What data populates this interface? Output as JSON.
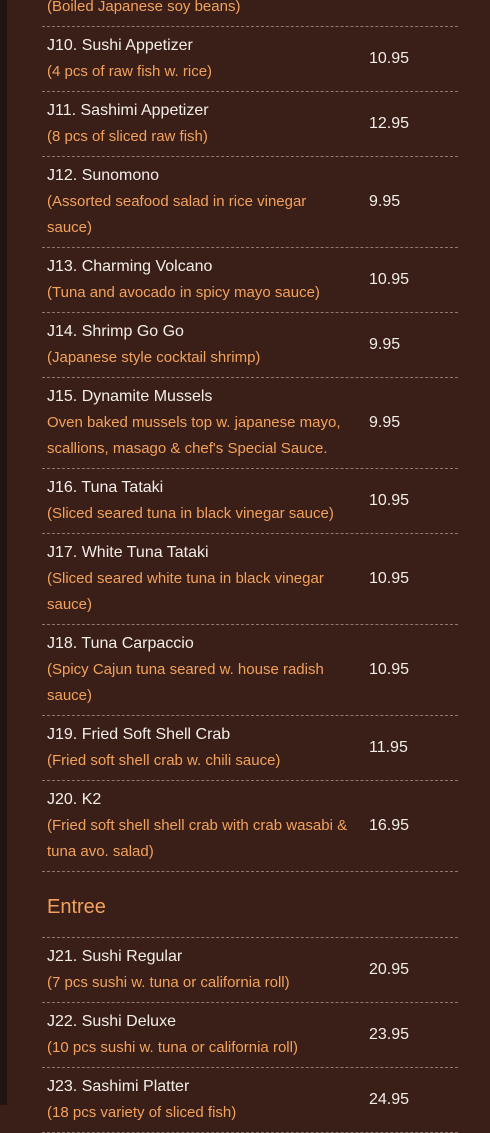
{
  "items_top": [
    {
      "name": "",
      "desc": "(Boiled Japanese soy beans)",
      "price": ""
    },
    {
      "name": "J10. Sushi Appetizer",
      "desc": "(4 pcs of raw fish w. rice)",
      "price": "10.95"
    },
    {
      "name": "J11. Sashimi Appetizer",
      "desc": "(8 pcs of sliced raw fish)",
      "price": "12.95"
    },
    {
      "name": "J12. Sunomono",
      "desc": "(Assorted seafood salad in rice vinegar sauce)",
      "price": "9.95"
    },
    {
      "name": "J13. Charming Volcano",
      "desc": "(Tuna and avocado in spicy mayo sauce)",
      "price": "10.95"
    },
    {
      "name": "J14. Shrimp Go Go",
      "desc": "(Japanese style cocktail shrimp)",
      "price": "9.95"
    },
    {
      "name": "J15. Dynamite Mussels",
      "desc": "Oven baked mussels top w. japanese mayo, scallions, masago & chef's Special Sauce.",
      "price": "9.95"
    },
    {
      "name": "J16. Tuna Tataki",
      "desc": "(Sliced seared tuna in black vinegar sauce)",
      "price": "10.95"
    },
    {
      "name": "J17. White Tuna Tataki",
      "desc": "(Sliced seared white tuna in black vinegar sauce)",
      "price": "10.95"
    },
    {
      "name": "J18. Tuna Carpaccio",
      "desc": "(Spicy Cajun tuna seared w. house radish sauce)",
      "price": "10.95"
    },
    {
      "name": "J19. Fried Soft Shell Crab",
      "desc": "(Fried soft shell crab w. chili sauce)",
      "price": "11.95"
    },
    {
      "name": "J20. K2",
      "desc": "(Fried soft shell shell crab with crab wasabi & tuna avo. salad)",
      "price": "16.95"
    }
  ],
  "section_title": "Entree",
  "items_entree": [
    {
      "name": "J21. Sushi Regular",
      "desc": "(7 pcs sushi w. tuna or california roll)",
      "price": "20.95"
    },
    {
      "name": "J22. Sushi Deluxe",
      "desc": "(10 pcs sushi w. tuna or california roll)",
      "price": "23.95"
    },
    {
      "name": "J23. Sashimi Platter",
      "desc": "(18 pcs variety of sliced fish)",
      "price": "24.95"
    }
  ]
}
